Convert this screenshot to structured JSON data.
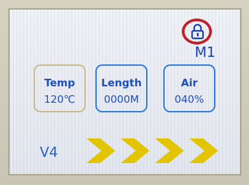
{
  "status": {
    "lock_icon": "lock-icon",
    "lock_highlight_color": "#c0202a"
  },
  "header": {
    "mode": "M1"
  },
  "cards": [
    {
      "label": "Temp",
      "value": "120℃"
    },
    {
      "label": "Length",
      "value": "0000M"
    },
    {
      "label": "Air",
      "value": "040%"
    }
  ],
  "footer": {
    "version": "V4",
    "arrow_icon": "chevron-right-icon",
    "arrow_count": 4,
    "arrow_color": "#e2c400"
  },
  "colors": {
    "text": "#1f4fb8",
    "card_border": "#2d7ad6",
    "temp_border": "#c9b98b"
  }
}
